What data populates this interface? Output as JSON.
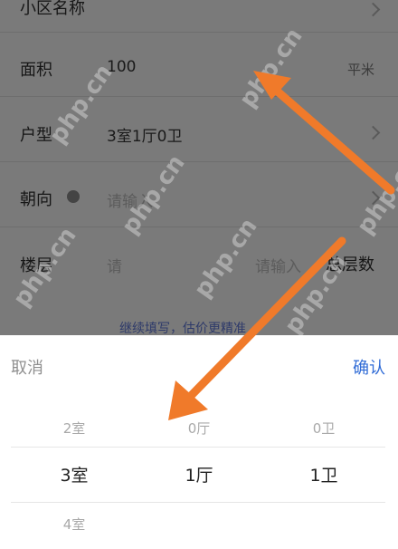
{
  "form": {
    "rows": [
      {
        "label": "小区名称",
        "value": "",
        "placeholder": "",
        "suffix": ""
      },
      {
        "label": "面积",
        "value": "100",
        "placeholder": "",
        "suffix": "平米"
      },
      {
        "label": "户型",
        "value": "3室1厅0卫",
        "placeholder": "",
        "suffix": ""
      },
      {
        "label": "朝向",
        "value": "",
        "placeholder": "请输入",
        "suffix": ""
      },
      {
        "label": "楼层",
        "value": "",
        "placeholder": "请",
        "placeholder2": "请输入",
        "suffix": "总层数"
      }
    ],
    "hint": "继续填写，估价更精准"
  },
  "picker": {
    "cancel": "取消",
    "confirm": "确认",
    "columns": [
      {
        "above": "2室",
        "selected": "3室",
        "below": "4室"
      },
      {
        "above": "0厅",
        "selected": "1厅",
        "below": ""
      },
      {
        "above": "0卫",
        "selected": "1卫",
        "below": ""
      }
    ]
  },
  "watermark": "php.cn",
  "colors": {
    "arrow": "#f07a2a",
    "confirm": "#2f6bd6",
    "overlay": "#7a7a7a"
  }
}
